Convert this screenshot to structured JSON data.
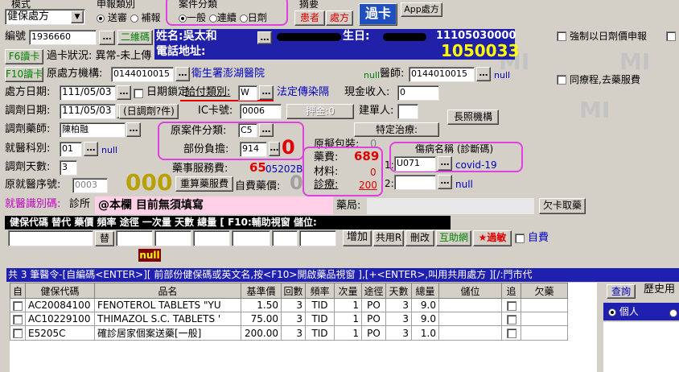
{
  "top": {
    "mode_label": "模式",
    "mode_value": "健保處方",
    "apply_type_label": "申報類別",
    "apply_opt1": "送審",
    "apply_opt2": "補報",
    "case_type_label": "案件分類",
    "case_opt1": "一般",
    "case_opt2": "連續",
    "case_opt3": "日劑",
    "summary_label": "摘要",
    "patient_btn": "患者",
    "rx_btn": "處方",
    "card_btn": "過卡",
    "app_btn": "App處方",
    "force_label": "強制以日劑價申報",
    "same_course_label": "同療程,去藥服費"
  },
  "patient": {
    "id_label": "編號",
    "id_value": "1936660",
    "second_code_btn": "二維碼",
    "name_label": "姓名:吳太和",
    "birthday_label": "生日:",
    "phone_label": "電話地址:",
    "code_top": "11105030000",
    "code_big": "1050033",
    "f6_btn": "F6讀卡",
    "card_status": "過卡狀況: 異常-未上傳",
    "f10_btn": "F10讀卡",
    "org_label": "原處方機構:",
    "org_value": "0144010015",
    "org_name": "衛生署澎湖醫院",
    "null1": "null",
    "doctor_label": "醫師:",
    "doctor_value": "0144010015",
    "null2": "null"
  },
  "form": {
    "rx_date_label": "處方日期:",
    "rx_date": "111/05/03",
    "date_lock_label": "日期鎖定",
    "pay_type_label": "給付類別:",
    "pay_type_value": "W",
    "pay_type_name": "法定傳染隔",
    "cash_label": "現金收入:",
    "cash_value": "0",
    "adj_date_label": "調劑日期:",
    "adj_date": "111/05/03",
    "adj_btn": "(日調劑?件)",
    "ic_label": "IC卡號:",
    "ic_value": "0006",
    "deposit_btn": "押金:0",
    "builder_label": "建單人:",
    "chronic_btn": "長照機構",
    "pharmacist_label": "調劑藥師:",
    "pharmacist_value": "陳柏融",
    "special_btn": "特定治療:",
    "orig_case_label": "原案件分類:",
    "orig_case_value": "C5",
    "orig_pack_label": "原擬包裝:",
    "orig_pack_value": "0",
    "dept_label": "就醫科別:",
    "dept_value": "01",
    "null3": "null",
    "copay_label": "部份負擔:",
    "copay_value": "914",
    "copay_big": "0",
    "adj_days_label": "調劑天數:",
    "adj_days_value": "3",
    "pharm_fee_label": "藥事服務費:",
    "pharm_fee_value": "65",
    "pharm_fee_code": "05202B",
    "self_pay_label": "自費藥價:",
    "self_pay_value": "0",
    "orig_seq_label": "原就醫序號:",
    "orig_seq_value": "0003",
    "big_zero": "000",
    "recalc_btn": "重算藥服費",
    "id_type_label": "就醫識別碼:",
    "id_type_value": "診所",
    "note_value": "@本欄 目前無須填寫",
    "pharmacy_label": "藥局:",
    "owe_btn": "欠卡取藥"
  },
  "fees": {
    "drug_label": "藥費:",
    "drug_value": "689",
    "material_label": "材料:",
    "material_value": "0",
    "diag_label": "診療:",
    "diag_value": "200"
  },
  "diagnosis": {
    "title": "傷病名稱 (診斷碼)",
    "row1_no": "1:",
    "row1_code": "U071",
    "row1_name": "covid-19",
    "row2_no": "2:",
    "row2_code": "",
    "row2_name": "null"
  },
  "order_bar": {
    "headers": "健保代碼   替代 藥價  頻率  途徑  一次量 天數 總量  [ F10:輔助視窗 儲位:",
    "add_btn": "增加",
    "share_btn": "共用R",
    "delete_btn": "刪改",
    "mutual_btn": "互助網",
    "allergy_btn": "★過敏",
    "self_pay_chk": "自費",
    "null_badge": "null"
  },
  "table": {
    "hint": "共 3 筆醫令-[自編碼<ENTER>][ 前部份健保碼或英文名,按<F10>開啟藥品視窗 ],[+<ENTER>,叫用共用處方 ][/:門市代",
    "columns": [
      "自",
      "健保代碼",
      "品名",
      "基準價",
      "回數",
      "頻率",
      "次量",
      "途徑",
      "天數",
      "總量",
      "儲位",
      "追",
      "欠藥"
    ],
    "rows": [
      [
        "",
        "AC20084100",
        "FENOTEROL TABLETS \"YU",
        "1.50",
        "3",
        "TID",
        "1",
        "PO",
        "3",
        "9.0",
        "",
        "",
        ""
      ],
      [
        "",
        "AC10229100",
        "THIMAZOL S.C. TABLETS '",
        "75.00",
        "3",
        "TID",
        "1",
        "PO",
        "3",
        "9.0",
        "",
        "",
        ""
      ],
      [
        "",
        "E5205C",
        "確診居家個案送藥[一般]",
        "200.00",
        "3",
        "TID",
        "1",
        "PO",
        "3",
        "1.0",
        "",
        "",
        ""
      ]
    ]
  },
  "history": {
    "query_btn": "查詢",
    "title": "歷史用",
    "personal": "個人"
  }
}
